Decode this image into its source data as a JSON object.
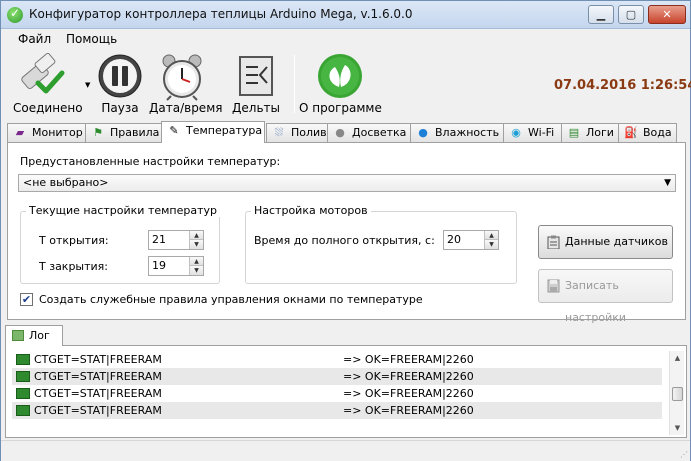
{
  "window": {
    "title": "Конфигуратор контроллера теплицы Arduino Mega, v.1.6.0.0"
  },
  "menu": [
    "Файл",
    "Помощь"
  ],
  "toolbar": {
    "connected": "Соединено",
    "pause": "Пауза",
    "datetime": "Дата/время",
    "deltas": "Дельты",
    "about": "О программе",
    "clock": "07.04.2016 1:26:54"
  },
  "tabs": [
    "Монитор",
    "Правила",
    "Температура",
    "Полив",
    "Досветка",
    "Влажность",
    "Wi-Fi",
    "Логи",
    "Вода"
  ],
  "active_tab": "Температура",
  "temperature": {
    "preset_label": "Предустановленные настройки температур:",
    "preset_value": "<не выбрано>",
    "current_group": "Текущие настройки температур",
    "open_label": "Т открытия:",
    "open_value": "21",
    "close_label": "Т закрытия:",
    "close_value": "19",
    "motors_group": "Настройка моторов",
    "full_open_label": "Время до полного открытия, с:",
    "full_open_value": "20",
    "sensor_button": "Данные датчиков",
    "save_button": "Записать настройки",
    "checkbox_label": "Создать служебные правила управления окнами по температуре",
    "checkbox_checked": true
  },
  "log": {
    "tab_label": "Лог",
    "rows": [
      {
        "cmd": "CTGET=STAT|FREERAM",
        "res": "=> OK=FREERAM|2260"
      },
      {
        "cmd": "CTGET=STAT|FREERAM",
        "res": "=> OK=FREERAM|2260"
      },
      {
        "cmd": "CTGET=STAT|FREERAM",
        "res": "=> OK=FREERAM|2260"
      },
      {
        "cmd": "CTGET=STAT|FREERAM",
        "res": "=> OK=FREERAM|2260"
      }
    ]
  },
  "colors": {
    "clock": "#8a3a12",
    "about_icon": "#3aa535"
  }
}
